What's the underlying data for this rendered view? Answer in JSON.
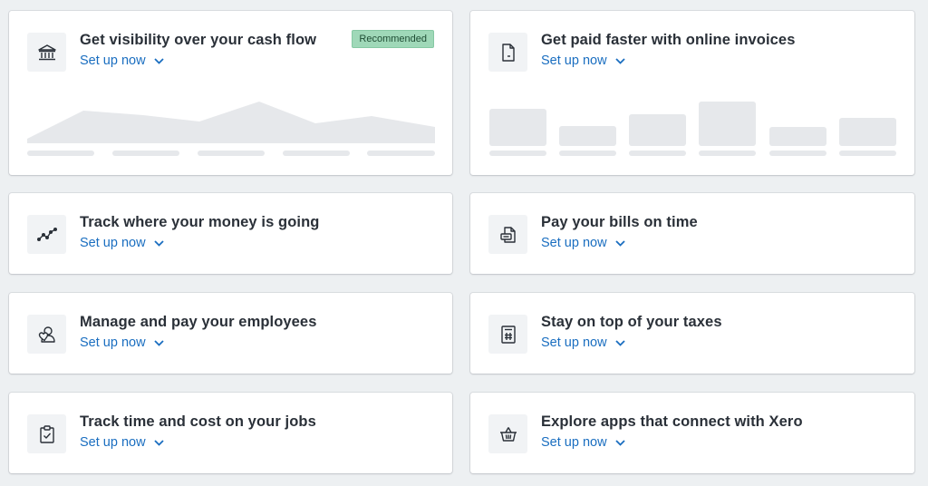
{
  "cards": [
    {
      "title": "Get visibility over your cash flow",
      "action": "Set up now",
      "icon": "bank-icon",
      "badge": "Recommended"
    },
    {
      "title": "Get paid faster with online invoices",
      "action": "Set up now",
      "icon": "invoice-icon"
    },
    {
      "title": "Track where your money is going",
      "action": "Set up now",
      "icon": "trend-line-icon"
    },
    {
      "title": "Pay your bills on time",
      "action": "Set up now",
      "icon": "bills-icon"
    },
    {
      "title": "Manage and pay your employees",
      "action": "Set up now",
      "icon": "employees-icon"
    },
    {
      "title": "Stay on top of your taxes",
      "action": "Set up now",
      "icon": "tax-calculator-icon"
    },
    {
      "title": "Track time and cost on your jobs",
      "action": "Set up now",
      "icon": "clipboard-check-icon"
    },
    {
      "title": "Explore apps that connect with Xero",
      "action": "Set up now",
      "icon": "basket-icon"
    }
  ],
  "colors": {
    "link": "#1a6ec0",
    "badge_bg": "#9fd8b8",
    "placeholder": "#e6e8eb"
  }
}
